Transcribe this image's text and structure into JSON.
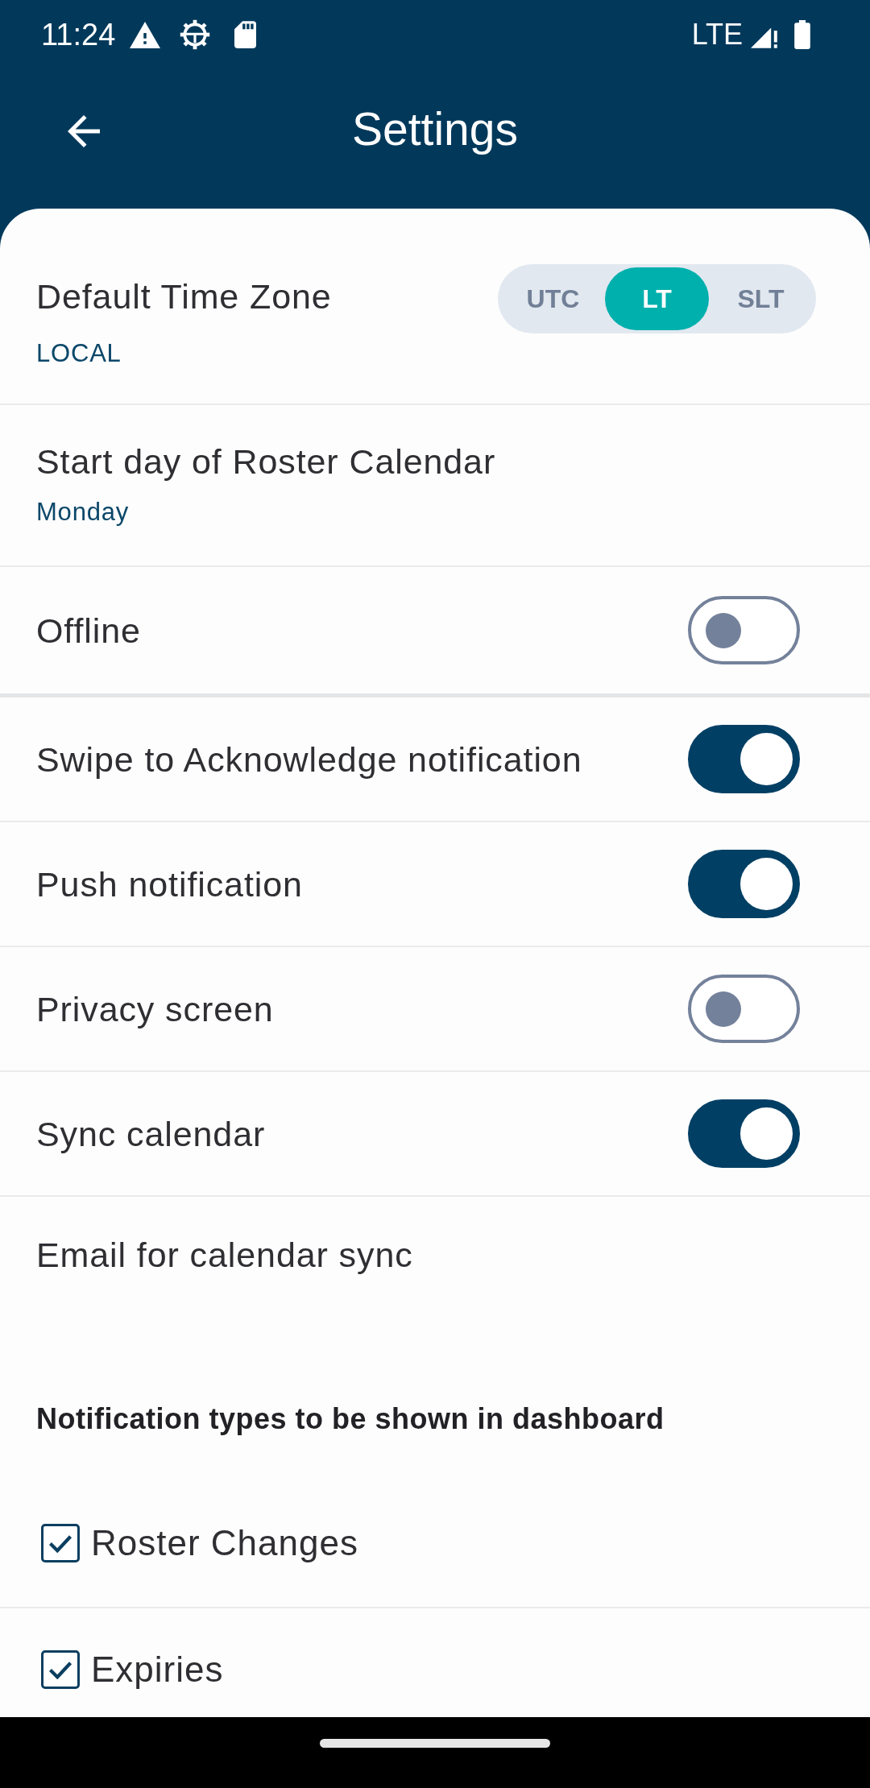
{
  "status_bar": {
    "time": "11:24",
    "network": "LTE"
  },
  "app_bar": {
    "title": "Settings"
  },
  "setting_groups": [
    {
      "items": [
        {
          "kind": "segmented",
          "label": "Default Time Zone",
          "value": "LOCAL",
          "options": [
            {
              "label": "UTC",
              "selected": false
            },
            {
              "label": "LT",
              "selected": true
            },
            {
              "label": "SLT",
              "selected": false
            }
          ]
        },
        {
          "kind": "value",
          "label": "Start day of Roster Calendar",
          "value": "Monday"
        },
        {
          "kind": "toggle",
          "label": "Offline",
          "on": false
        }
      ]
    },
    {
      "items": [
        {
          "kind": "toggle",
          "label": "Swipe to Acknowledge notification",
          "on": true
        },
        {
          "kind": "toggle",
          "label": "Push notification",
          "on": true
        },
        {
          "kind": "toggle",
          "label": "Privacy screen",
          "on": false
        },
        {
          "kind": "toggle",
          "label": "Sync calendar",
          "on": true
        },
        {
          "kind": "label",
          "label": "Email for calendar sync"
        }
      ]
    }
  ],
  "notification_types": {
    "heading": "Notification types to be shown in dashboard",
    "items": [
      {
        "label": "Roster Changes",
        "checked": true
      },
      {
        "label": "Expiries",
        "checked": true
      }
    ]
  }
}
